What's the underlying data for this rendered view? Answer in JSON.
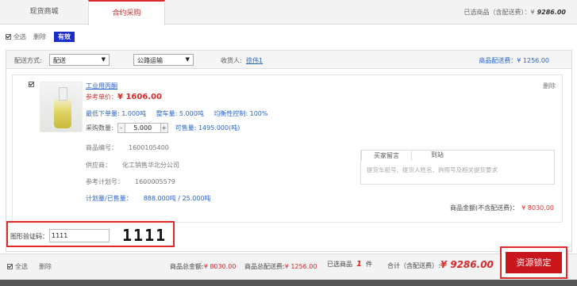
{
  "tabs": [
    {
      "label": "现货商城"
    },
    {
      "label": "合约采购"
    }
  ],
  "selected_summary": {
    "label": "已选商品（含配送费）：¥",
    "amount": "9286.00"
  },
  "filter": {
    "select_all": "全选",
    "delete": "删除",
    "valid": "有效"
  },
  "delivery": {
    "method_label": "配送方式:",
    "method_value": "配送",
    "transport_value": "公路运输",
    "receiver_label": "收货人:",
    "receiver_name": "徐伟1",
    "fee_text": "商品配送费：¥ 1256.00"
  },
  "product": {
    "name": "工业用丙酮",
    "price_label": "参考单价：",
    "price_value": "¥ 1606.00",
    "delete": "删除",
    "min_order": "最低下单量: 1.000吨",
    "whole_car": "整车量: 5.000吨",
    "balance": "均衡性控制: 100%",
    "qty_label": "采购数量:",
    "qty_minus": "-",
    "qty_value": "5.000",
    "qty_plus": "+",
    "available": "可售量: 1495.000(吨)",
    "code_label": "商品编号：",
    "code_value": "1600105400",
    "supplier_label": "供应商：",
    "supplier_value": "化工销售华北分公司",
    "plan_label": "参考计划号：",
    "plan_value": "1600005579",
    "plan_sold_label": "计划量/已售量：",
    "plan_sold_value": "888.000吨 / 25.000吨",
    "message_tab": "买家留言",
    "station_tab": "到站",
    "message_placeholder": "提货车船号、提货人姓名、驹照号及相关提货要求",
    "total_label": "商品金额(不含配送费)：",
    "total_value": "¥ 8030.00"
  },
  "captcha": {
    "label": "图形验证码：",
    "input_value": "1111",
    "image_text": "1111"
  },
  "footer": {
    "select_all": "全选",
    "delete": "删除",
    "goods_total_label": "商品总金额:",
    "goods_total_value": "¥ 8030.00",
    "fee_total_label": "商品总配送费:",
    "fee_total_value": "¥ 1256.00",
    "selected_label": "已选商品",
    "selected_count": "1",
    "selected_unit": "件",
    "grand_label": "合计（含配送费）:",
    "grand_value": "¥ 9286.00",
    "lock_button": "资源锁定"
  },
  "colors": {
    "accent": "#d62b2b",
    "link": "#2a63c8",
    "valid_badge": "#1a2cc9",
    "button": "#c9161c"
  },
  "icons": {
    "checkbox": "checkbox-checked-icon",
    "dropdown": "chevron-down-icon"
  }
}
